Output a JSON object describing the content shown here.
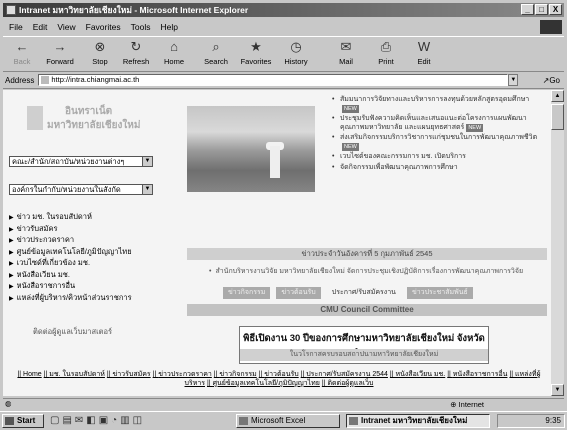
{
  "window": {
    "title": "Intranet มหาวิทยาลัยเชียงใหม่ - Microsoft Internet Explorer",
    "min": "_",
    "max": "□",
    "close": "X"
  },
  "menu": [
    "File",
    "Edit",
    "View",
    "Favorites",
    "Tools",
    "Help"
  ],
  "toolbar": [
    {
      "label": "Back",
      "icon": "←"
    },
    {
      "label": "Forward",
      "icon": "→"
    },
    {
      "label": "Stop",
      "icon": "⊗"
    },
    {
      "label": "Refresh",
      "icon": "↻"
    },
    {
      "label": "Home",
      "icon": "⌂"
    },
    {
      "label": "Search",
      "icon": "⌕"
    },
    {
      "label": "Favorites",
      "icon": "★"
    },
    {
      "label": "History",
      "icon": "◷"
    },
    {
      "label": "Mail",
      "icon": "✉"
    },
    {
      "label": "Print",
      "icon": "⎙"
    },
    {
      "label": "Edit",
      "icon": "W"
    }
  ],
  "address": {
    "label": "Address",
    "url": "http://intra.chiangmai.ac.th",
    "go": "Go"
  },
  "page": {
    "logo_line1": "อินทราเน็ต",
    "logo_line2": "มหาวิทยาลัยเชียงใหม่",
    "select1": "คณะ/สำนัก/สถาบัน/หน่วยงานต่างๆ",
    "select2": "องค์กรในกำกับ/หน่วยงานในสังกัด",
    "left_links": [
      "ข่าว มช. ในรอบสัปดาห์",
      "ข่าวรับสมัคร",
      "ข่าวประกวดราคา",
      "ศูนย์ข้อมูลเทคโนโลยี/ภูมิปัญญาไทย",
      "เวบไซด์ที่เกี่ยวข้อง มช.",
      "หนังสือเวียน มช.",
      "หนังสือราชการอื่น",
      "แหล่งที่ผู้บริหาร/คิวหน้าส่วนราชการ"
    ],
    "contact": "ติดต่อผู้ดูแลเว็บมาสเตอร์",
    "news": [
      "สัมมนาการวิจัยทางและบริหารการลงทุนด้วยหลักสูตรอุดมศึกษา",
      "ประชุมรับฟังความคิดเห็นและเสนอแนะต่อโครงการแผนพัฒนาคุณภาพมหาวิทยาลัย และแผนยุทธศาสตร์",
      "ส่งเสริมกิจกรรมบริการวิชาการแก่ชุมชนในการพัฒนาคุณภาพชีวิต",
      "เวบไซต์ของคณะกรรมการ มช. เปิดบริการ",
      "จัดกิจกรรมเพื่อพัฒนาคุณภาพการศึกษา"
    ],
    "new_badge": "NEW",
    "date_bar": "ข่าวประจำวันอังคารที่ 5 กุมภาพันธ์ 2545",
    "announcement": "สำนักบริหารงานวิจัย มหาวิทยาลัยเชียงใหม่ จัดการประชุมเชิงปฏิบัติการเรื่องการพัฒนาคุณภาพการวิจัย",
    "tabs": [
      "ข่าวกิจกรรม",
      "ข่าวต้อนรับ",
      "ประกาศ/รับสมัครงาน",
      "ข่าวประชาสัมพันธ์"
    ],
    "council": "CMU Council Committee",
    "banner_title": "พิธีเปิดงาน 30 ปีของการศึกษามหาวิทยาลัยเชียงใหม่ จังหวัดลำพูน",
    "banner_sub": "ในวโรกาสครบรอบสถาปนามหาวิทยาลัยเชียงใหม่",
    "footer_links": [
      "Home",
      "มช. ในรอบสัปดาห์",
      "ข่าวรับสมัคร",
      "ข่าวประกวดราคา",
      "ข่าวกิจกรรม",
      "ข่าวต้อนรับ",
      "ประกาศ/รับสมัครงาน 2544",
      "หนังสือเวียน มช.",
      "หนังสือราชการอื่น",
      "แหล่งที่ผู้บริหาร",
      "ศูนย์ข้อมูลเทคโนโลยี/ภูมิปัญญาไทย",
      "ติดต่อผู้ดูแลเว็บ"
    ]
  },
  "status": {
    "zone": "Internet"
  },
  "taskbar": {
    "start": "Start",
    "tasks": [
      "Microsoft Excel",
      "Intranet มหาวิทยาลัยเชียงใหม่"
    ],
    "clock": "9:35"
  }
}
